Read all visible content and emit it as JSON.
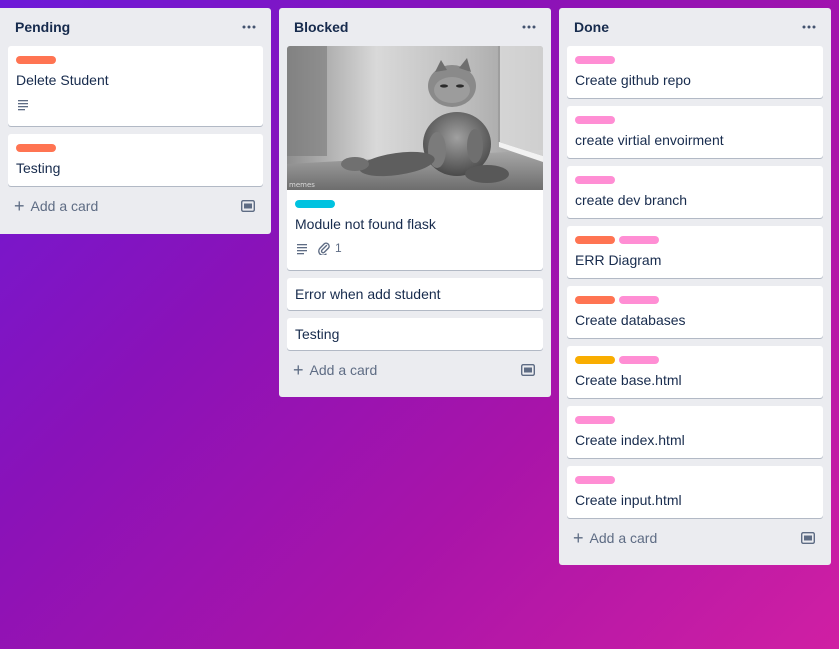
{
  "colors": {
    "red": "#ff7452",
    "pink": "#ff8ed4",
    "cyan": "#00c2e0",
    "orange": "#f9ad00",
    "list_bg": "#ebecf0",
    "card_bg": "#ffffff"
  },
  "lists": [
    {
      "title": "Pending",
      "menu_icon": "ellipsis-icon",
      "add_card_label": "Add a card",
      "cards": [
        {
          "title": "Delete Student",
          "labels": [
            "red"
          ],
          "badges": {
            "description": true
          }
        },
        {
          "title": "Testing",
          "labels": [
            "red"
          ],
          "badges": {}
        }
      ]
    },
    {
      "title": "Blocked",
      "menu_icon": "ellipsis-icon",
      "add_card_label": "Add a card",
      "cards": [
        {
          "title": "Module not found flask",
          "labels": [
            "cyan"
          ],
          "cover": "cat-cover-image",
          "cover_watermark": "memes",
          "badges": {
            "description": true,
            "attachments": "1"
          }
        },
        {
          "title": "Error when add student",
          "labels": [],
          "badges": {}
        },
        {
          "title": "Testing",
          "labels": [],
          "badges": {}
        }
      ]
    },
    {
      "title": "Done",
      "menu_icon": "ellipsis-icon",
      "add_card_label": "Add a card",
      "cards": [
        {
          "title": "Create github repo",
          "labels": [
            "pink"
          ]
        },
        {
          "title": "create virtial envoirment",
          "labels": [
            "pink"
          ]
        },
        {
          "title": "create dev branch",
          "labels": [
            "pink"
          ]
        },
        {
          "title": "ERR Diagram",
          "labels": [
            "red",
            "pink"
          ]
        },
        {
          "title": "Create databases",
          "labels": [
            "red",
            "pink"
          ]
        },
        {
          "title": "Create base.html",
          "labels": [
            "orange",
            "pink"
          ]
        },
        {
          "title": "Create index.html",
          "labels": [
            "pink"
          ]
        },
        {
          "title": "Create input.html",
          "labels": [
            "pink"
          ]
        }
      ]
    }
  ]
}
